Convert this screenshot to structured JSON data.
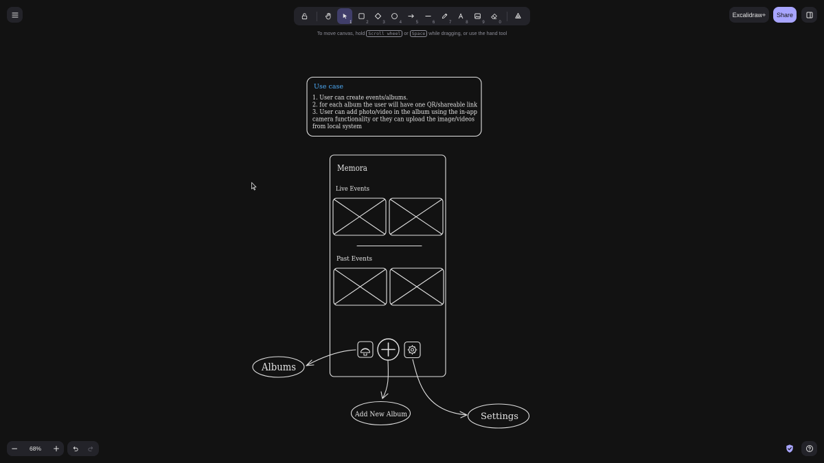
{
  "toolbar": {
    "tools": [
      {
        "name": "lock",
        "key": ""
      },
      {
        "name": "hand",
        "key": ""
      },
      {
        "name": "selection",
        "key": "1"
      },
      {
        "name": "rectangle",
        "key": "2"
      },
      {
        "name": "diamond",
        "key": "3"
      },
      {
        "name": "ellipse",
        "key": "4"
      },
      {
        "name": "arrow",
        "key": "5"
      },
      {
        "name": "line",
        "key": "6"
      },
      {
        "name": "draw",
        "key": "7"
      },
      {
        "name": "text",
        "key": "8"
      },
      {
        "name": "image",
        "key": "9"
      },
      {
        "name": "eraser",
        "key": "0"
      },
      {
        "name": "extra-tools",
        "key": ""
      }
    ],
    "active_tool": "selection"
  },
  "hint": {
    "prefix": "To move canvas, hold",
    "key1": "Scroll wheel",
    "mid": "or",
    "key2": "Space",
    "suffix": "while dragging, or use the hand tool"
  },
  "header": {
    "plus_label": "Excalidraw+",
    "share_label": "Share"
  },
  "footer": {
    "zoom": "68%",
    "zoom_out": "−",
    "zoom_in": "+"
  },
  "canvas": {
    "usecase": {
      "title": "Use case",
      "lines": [
        "1. User can create events/albums.",
        "2. for each album the user will have one QR/shareable link",
        "3. User can add photo/video in the album using the in-app",
        "camera functionality or they can upload the image/videos",
        "from local system"
      ]
    },
    "phone": {
      "app_name": "Memora",
      "live_label": "Live Events",
      "past_label": "Past Events"
    },
    "labels": {
      "albums": "Albums",
      "add_album": "Add New Album",
      "settings": "Settings"
    }
  },
  "colors": {
    "background": "#121212",
    "panel": "#232329",
    "accent": "#a8a5ff",
    "active_tool": "#403e6a",
    "stroke": "#e3e3e3",
    "usecase_title": "#4dabf7"
  }
}
